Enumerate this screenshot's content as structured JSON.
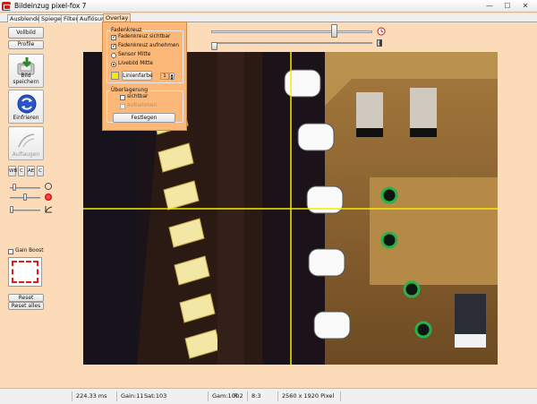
{
  "window": {
    "title": "Bildeinzug  pixel-fox 7",
    "minimize": "—",
    "maximize": "☐",
    "close": "✕"
  },
  "tabs": [
    {
      "label": "Ausblenden"
    },
    {
      "label": "Spiegeln"
    },
    {
      "label": "Filter"
    },
    {
      "label": "Auflösung"
    },
    {
      "label": "Overlay",
      "active": true
    }
  ],
  "sidebar": {
    "vollbild": "Vollbild",
    "profile": "Profile",
    "bild_speichern": "Bild speichern",
    "einfrieren": "Einfrieren",
    "auflaugen": "Auflaugen",
    "small_buttons": [
      "WB",
      "C",
      "AE",
      "C"
    ],
    "gain_boost": "Gain Boost",
    "reset_bereich": "Reset Bereich",
    "reset_alles": "Reset alles"
  },
  "overlay_panel": {
    "fadenkreuz_title": "Fadenkreuz",
    "fadenkreuz_sichtbar": {
      "label": "Fadenkreuz sichtbar",
      "checked": true
    },
    "fadenkreuz_aufnehmen": {
      "label": "Fadenkreuz aufnehmen",
      "checked": true
    },
    "sensor_mitte": {
      "label": "Sensor Mitte",
      "checked": false
    },
    "livebild_mitte": {
      "label": "Livebild Mitte",
      "checked": true
    },
    "linienfarbe": "Linienfarbe",
    "linienfarbe_value": "#f6ea00",
    "ueberlagerung_title": "Überlagerung",
    "sichtbar": {
      "label": "sichtbar",
      "checked": false
    },
    "aufnehmen": {
      "label": "aufnehmen",
      "checked": false,
      "disabled": true
    },
    "festlegen": "Festlegen"
  },
  "statusbar": {
    "time": "224.33 ms",
    "gain": "Gain:11",
    "sat": "Sat:103",
    "gam": "Gam:100",
    "r": "R:2",
    "ratio": "8:3",
    "resolution": "2560 x 1920 Pixel"
  },
  "colors": {
    "background": "#fcdcb8",
    "panel": "#fcb878",
    "crosshair": "#f6ea00"
  }
}
